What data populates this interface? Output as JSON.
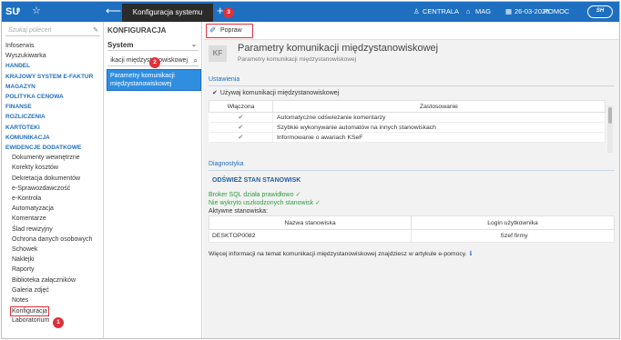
{
  "topbar": {
    "logo": "SU",
    "logo_mark": "M",
    "tab_title": "Konfiguracja systemu",
    "user": "CENTRALA",
    "warehouse": "MAG",
    "date": "26-03-2026",
    "help": "POMOC",
    "brand": "SH"
  },
  "sidebar": {
    "search_placeholder": "Szukaj poleceń",
    "items": [
      {
        "label": "Infoserwis",
        "kind": "item"
      },
      {
        "label": "Wyszukiwarka",
        "kind": "item"
      },
      {
        "label": "HANDEL",
        "kind": "header"
      },
      {
        "label": "KRAJOWY SYSTEM E-FAKTUR",
        "kind": "header"
      },
      {
        "label": "MAGAZYN",
        "kind": "header"
      },
      {
        "label": "POLITYKA CENOWA",
        "kind": "header"
      },
      {
        "label": "FINANSE",
        "kind": "header"
      },
      {
        "label": "ROZLICZENIA",
        "kind": "header"
      },
      {
        "label": "KARTOTEKI",
        "kind": "header"
      },
      {
        "label": "KOMUNIKACJA",
        "kind": "header"
      },
      {
        "label": "EWIDENCJE DODATKOWE",
        "kind": "header"
      },
      {
        "label": "Dokumenty wewnętrzne",
        "kind": "sub"
      },
      {
        "label": "Korekty kosztów",
        "kind": "sub"
      },
      {
        "label": "Dekretacja dokumentów",
        "kind": "sub"
      },
      {
        "label": "e-Sprawozdawczość",
        "kind": "sub"
      },
      {
        "label": "e-Kontrola",
        "kind": "sub"
      },
      {
        "label": "Automatyzacja",
        "kind": "sub"
      },
      {
        "label": "Komentarze",
        "kind": "sub"
      },
      {
        "label": "Ślad rewizyjny",
        "kind": "sub"
      },
      {
        "label": "Ochrona danych osobowych",
        "kind": "sub"
      },
      {
        "label": "Schowek",
        "kind": "sub"
      },
      {
        "label": "Naklejki",
        "kind": "sub"
      },
      {
        "label": "Raporty",
        "kind": "sub"
      },
      {
        "label": "Biblioteka załączników",
        "kind": "sub"
      },
      {
        "label": "Galeria zdjęć",
        "kind": "sub"
      },
      {
        "label": "Notes",
        "kind": "sub"
      },
      {
        "label": "Konfiguracja",
        "kind": "selected"
      },
      {
        "label": "Laboratorium",
        "kind": "sub"
      }
    ]
  },
  "middle": {
    "title": "KONFIGURACJA",
    "system_select": "System",
    "search_value": "ikacji międzystanowiskowej",
    "result_line1": "Parametry komunikacji",
    "result_line2": "międzystanowiskowej"
  },
  "toolbar": {
    "popraw": "Popraw"
  },
  "page": {
    "kf": "KF",
    "title": "Parametry komunikacji międzystanowiskowej",
    "subtitle": "Parametry komunikacji międzystanowiskowej"
  },
  "settings": {
    "section": "Ustawienia",
    "checkbox_label": "Używaj komunikacji międzystanowiskowej",
    "col_enabled": "Włączona",
    "col_usage": "Zastosowanie",
    "rows": [
      {
        "check": "✔",
        "label": "Automatyczne odświeżanie komentarzy"
      },
      {
        "check": "✔",
        "label": "Szybkie wykonywanie automatów na innych stanowiskach"
      },
      {
        "check": "✔",
        "label": "Informowanie o awariach KSeF"
      }
    ]
  },
  "diagnostics": {
    "section": "Diagnostyka",
    "refresh": "ODŚWIEŻ STAN STANOWISK",
    "ok1": "Broker SQL działa prawidłowo ✓",
    "ok2": "Nie wykryto uszkodzonych stanowisk ✓",
    "active": "Aktywne stanowiska:",
    "col_station": "Nazwa stanowiska",
    "col_login": "Login użytkownika",
    "stations": [
      {
        "name": "DESKTOP0082",
        "login": "Szef firmy"
      }
    ],
    "info": "Więcej informacji na temat komunikacji międzystanowiskowej znajdziesz w artykule e-pomocy."
  },
  "badges": {
    "b1": "1",
    "b2": "2",
    "b3": "3"
  },
  "colors": {
    "accent": "#1e6fc0",
    "highlight": "#e0303a",
    "success": "#2e9e3e"
  }
}
